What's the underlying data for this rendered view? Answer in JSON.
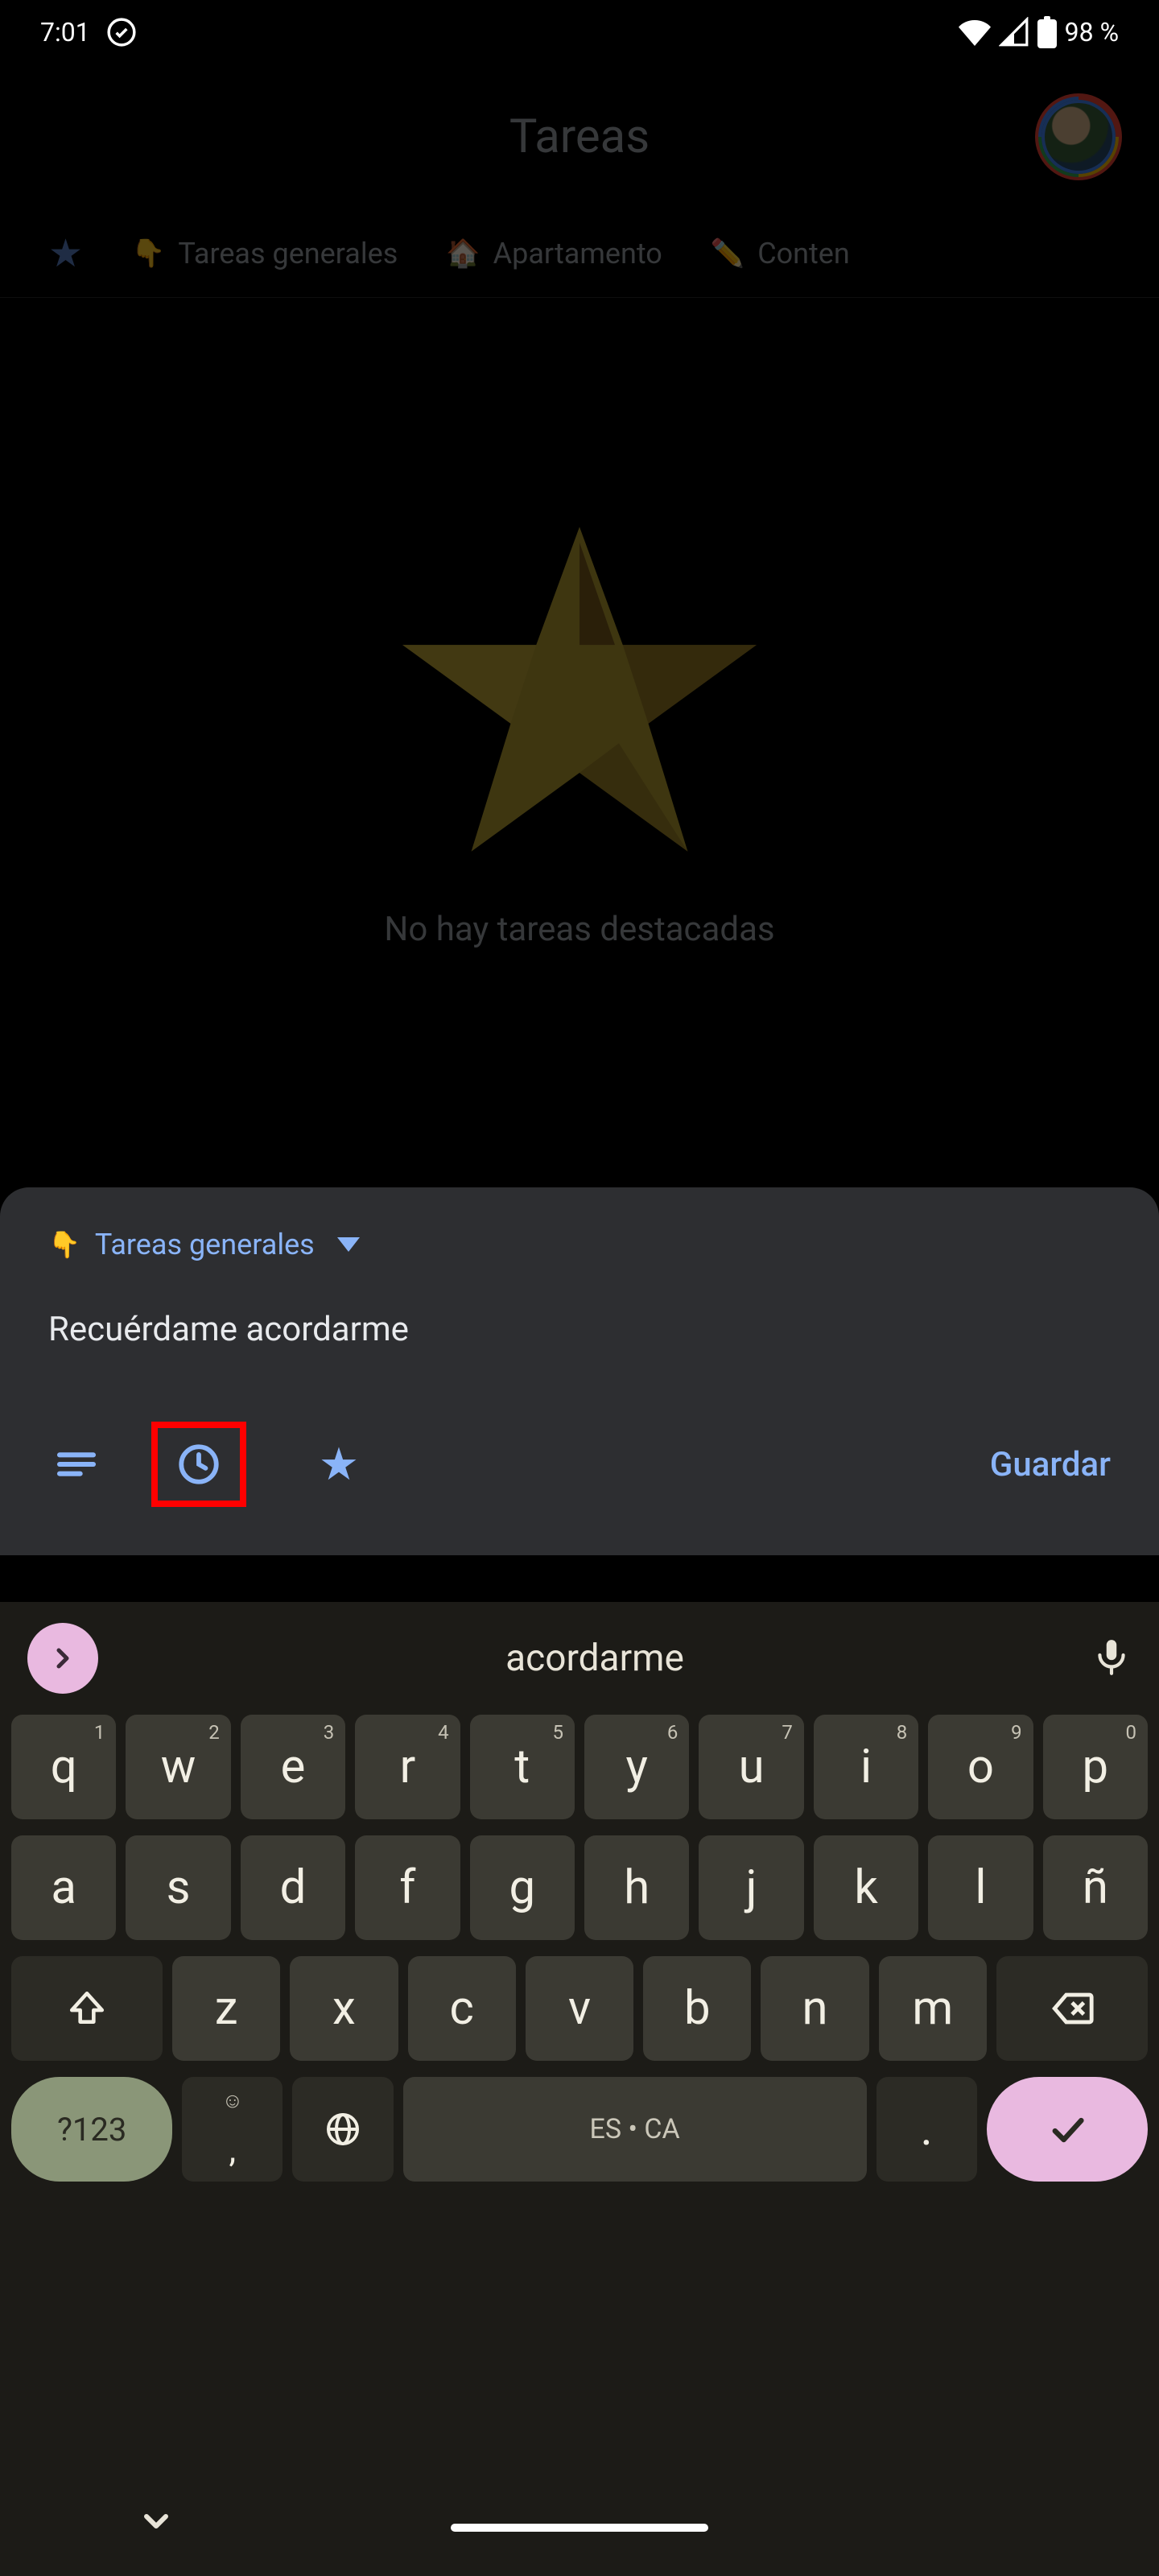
{
  "status_bar": {
    "time": "7:01",
    "battery": "98 %"
  },
  "header": {
    "title": "Tareas"
  },
  "tabs": {
    "t1_label": "Tareas generales",
    "t2_label": "Apartamento",
    "t3_label": "Conten"
  },
  "empty_state": {
    "title": "No hay tareas destacadas"
  },
  "sheet": {
    "list_name": "Tareas generales",
    "task_text": "Recuérdame acordarme",
    "save_label": "Guardar"
  },
  "keyboard": {
    "suggestion": "acordarme",
    "row1": [
      "q",
      "w",
      "e",
      "r",
      "t",
      "y",
      "u",
      "i",
      "o",
      "p"
    ],
    "row1_sup": [
      "1",
      "2",
      "3",
      "4",
      "5",
      "6",
      "7",
      "8",
      "9",
      "0"
    ],
    "row2": [
      "a",
      "s",
      "d",
      "f",
      "g",
      "h",
      "j",
      "k",
      "l",
      "ñ"
    ],
    "row3": [
      "z",
      "x",
      "c",
      "v",
      "b",
      "n",
      "m"
    ],
    "numkey": "?123",
    "space_label": "ES • CA",
    "period": ".",
    "comma": ","
  }
}
